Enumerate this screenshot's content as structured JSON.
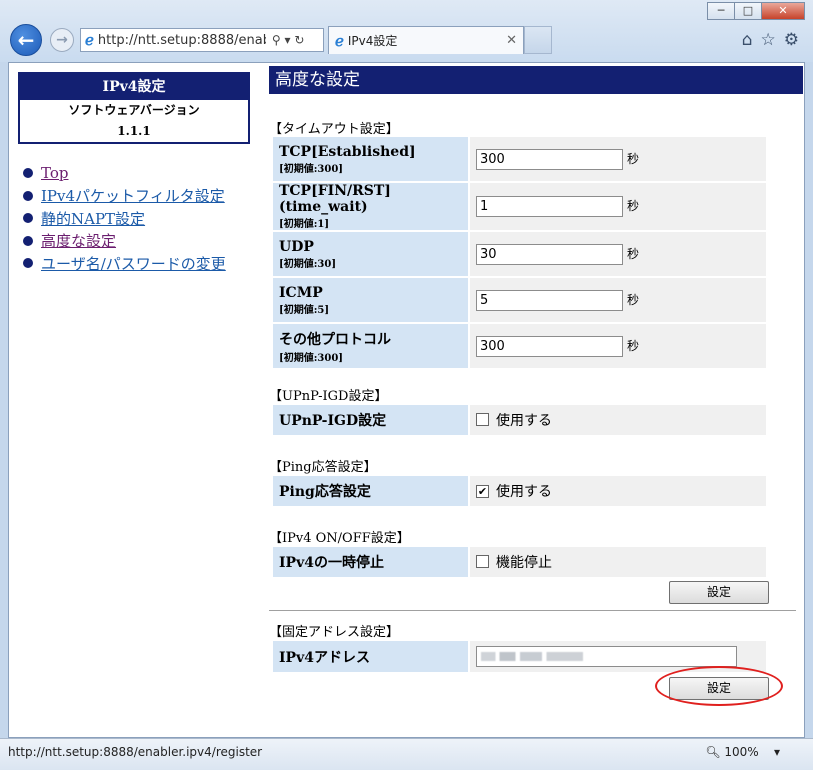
{
  "browser": {
    "address_url": "http://ntt.setup:8888/enabl",
    "address_controls": "⚲ ▾ ↻",
    "tab_title": "IPv4設定",
    "status_url": "http://ntt.setup:8888/enabler.ipv4/register",
    "zoom": "100%"
  },
  "sidebar": {
    "box_title": "IPv4設定",
    "software_label": "ソフトウェアバージョン",
    "version": "1.1.1",
    "items": [
      {
        "label": "Top",
        "visited": true
      },
      {
        "label": "IPv4パケットフィルタ設定",
        "visited": false
      },
      {
        "label": "静的NAPT設定",
        "visited": false
      },
      {
        "label": "高度な設定",
        "visited": true
      },
      {
        "label": "ユーザ名/パスワードの変更",
        "visited": false
      }
    ]
  },
  "main": {
    "title": "高度な設定",
    "timeout": {
      "heading": "【タイムアウト設定】",
      "unit": "秒",
      "rows": [
        {
          "label": "TCP[Established]",
          "default": "[初期値:300]",
          "value": "300"
        },
        {
          "label": "TCP[FIN/RST](time_wait)",
          "default": "[初期値:1]",
          "value": "1"
        },
        {
          "label": "UDP",
          "default": "[初期値:30]",
          "value": "30"
        },
        {
          "label": "ICMP",
          "default": "[初期値:5]",
          "value": "5"
        },
        {
          "label": "その他プロトコル",
          "default": "[初期値:300]",
          "value": "300"
        }
      ]
    },
    "upnp": {
      "heading": "【UPnP-IGD設定】",
      "label": "UPnP-IGD設定",
      "option": "使用する",
      "checked": false
    },
    "ping": {
      "heading": "【Ping応答設定】",
      "label": "Ping応答設定",
      "option": "使用する",
      "checked": true
    },
    "ipv4": {
      "heading": "【IPv4 ON/OFF設定】",
      "label": "IPv4の一時停止",
      "option": "機能停止",
      "checked": false
    },
    "apply_button": "設定",
    "fixed": {
      "heading": "【固定アドレス設定】",
      "label": "IPv4アドレス",
      "button": "設定"
    }
  }
}
